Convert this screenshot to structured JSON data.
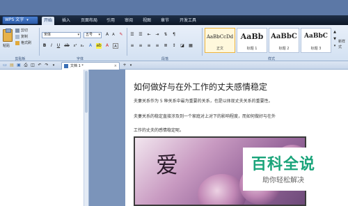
{
  "app": {
    "name": "WPS 文字",
    "menu_caret": "▾"
  },
  "tabs": [
    "开始",
    "插入",
    "页面布局",
    "引用",
    "审阅",
    "视图",
    "章节",
    "开发工具"
  ],
  "active_tab": "开始",
  "clipboard": {
    "paste": "粘贴",
    "cut": "剪切",
    "copy": "复制",
    "format_painter": "格式刷",
    "group_label": "剪贴板"
  },
  "font": {
    "family": "宋体",
    "size": "五号",
    "group_label": "字体"
  },
  "paragraph": {
    "group_label": "段落"
  },
  "styles": {
    "group_label": "样式",
    "items": [
      {
        "sample": "AaBbCcDd",
        "name": "正文"
      },
      {
        "sample": "AaBb",
        "name": "标题 1"
      },
      {
        "sample": "AaBbC",
        "name": "标题 2"
      },
      {
        "sample": "AaBbC",
        "name": "标题 3"
      }
    ],
    "new_style": "新样式"
  },
  "document_tab": {
    "title": "文档 1 *",
    "close": "×",
    "add": "+"
  },
  "document": {
    "title": "如何做好与在外工作的丈夫感情稳定",
    "lines": [
      "夫妻关系作为 5 种关系中最为重要的关系，也是以体现丈夫关系的重要性。",
      "夫妻关系的稳定直接涉及到一个家庭对上对下的影响程度，而如何做好与在外",
      "工作的丈夫的感情稳定呢。"
    ]
  },
  "image": {
    "calligraphy": "爱"
  },
  "watermark": {
    "title": "百科全说",
    "subtitle": "助你轻松解决"
  },
  "colors": {
    "accent": "#1aa47a",
    "ribbon": "#dfe9f7",
    "menubar": "#16223a"
  }
}
